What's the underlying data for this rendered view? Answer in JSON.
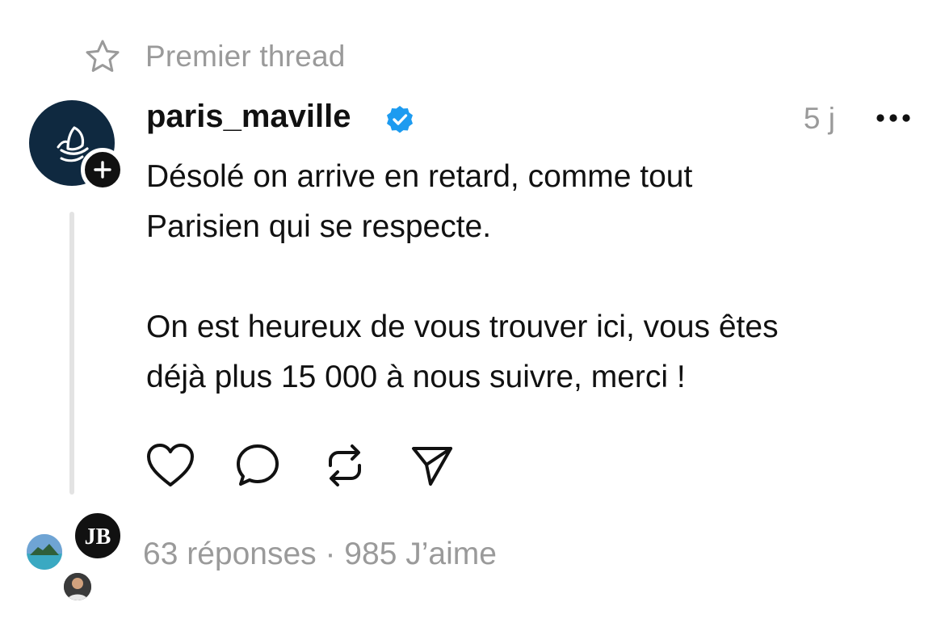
{
  "pinned": {
    "icon": "star-icon",
    "label": "Premier thread"
  },
  "post": {
    "author": {
      "username": "paris_maville",
      "verified": true,
      "avatar_icon": "boat-logo-icon",
      "follow_icon": "plus-icon"
    },
    "timestamp": "5 j",
    "more_icon": "more-icon",
    "paragraphs": [
      "Désolé on arrive en retard, comme tout\nParisien qui se respecte.",
      "On est heureux de vous trouver ici, vous êtes\ndéjà plus 15 000 à nous suivre, merci !"
    ],
    "actions": [
      {
        "name": "like",
        "icon": "heart-icon"
      },
      {
        "name": "reply",
        "icon": "comment-icon"
      },
      {
        "name": "repost",
        "icon": "repost-icon"
      },
      {
        "name": "share",
        "icon": "send-icon"
      }
    ],
    "stats": "63 réponses · 985 J’aime",
    "replier_avatars": [
      {
        "icon": "jb-logo-icon",
        "text": "JB"
      },
      {
        "icon": "landscape-avatar-icon"
      },
      {
        "icon": "person-avatar-icon"
      }
    ]
  },
  "colors": {
    "text": "#111111",
    "muted": "#9a9a9a",
    "verified": "#1d9bf0",
    "avatar_bg": "#0f2940",
    "thread_line": "#e3e3e3"
  }
}
